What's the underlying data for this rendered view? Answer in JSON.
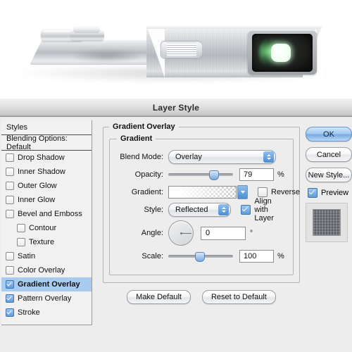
{
  "photo": {
    "subject": "brushed-aluminum camera body with lens",
    "parts": [
      "dial-knob-large",
      "dial-knob-small",
      "ridged-grille",
      "lens-housing",
      "lens-highlight"
    ]
  },
  "dialog": {
    "title": "Layer Style"
  },
  "styles_panel": {
    "header": "Styles",
    "blending_options": "Blending Options: Default",
    "items": [
      {
        "label": "Drop Shadow",
        "checked": false,
        "indent": false,
        "selected": false
      },
      {
        "label": "Inner Shadow",
        "checked": false,
        "indent": false,
        "selected": false
      },
      {
        "label": "Outer Glow",
        "checked": false,
        "indent": false,
        "selected": false
      },
      {
        "label": "Inner Glow",
        "checked": false,
        "indent": false,
        "selected": false
      },
      {
        "label": "Bevel and Emboss",
        "checked": false,
        "indent": false,
        "selected": false
      },
      {
        "label": "Contour",
        "checked": false,
        "indent": true,
        "selected": false
      },
      {
        "label": "Texture",
        "checked": false,
        "indent": true,
        "selected": false
      },
      {
        "label": "Satin",
        "checked": false,
        "indent": false,
        "selected": false
      },
      {
        "label": "Color Overlay",
        "checked": false,
        "indent": false,
        "selected": false
      },
      {
        "label": "Gradient Overlay",
        "checked": true,
        "indent": false,
        "selected": true
      },
      {
        "label": "Pattern Overlay",
        "checked": true,
        "indent": false,
        "selected": false
      },
      {
        "label": "Stroke",
        "checked": true,
        "indent": false,
        "selected": false
      }
    ]
  },
  "gradient_panel": {
    "section_title": "Gradient Overlay",
    "group_title": "Gradient",
    "blend_mode": {
      "label": "Blend Mode:",
      "value": "Overlay"
    },
    "opacity": {
      "label": "Opacity:",
      "value": "79",
      "unit": "%",
      "percent": 72
    },
    "gradient": {
      "label": "Gradient:"
    },
    "reverse": {
      "label": "Reverse",
      "checked": false
    },
    "style": {
      "label": "Style:",
      "value": "Reflected"
    },
    "align_with_layer": {
      "label": "Align with Layer",
      "checked": true
    },
    "angle": {
      "label": "Angle:",
      "value": "0",
      "unit": "°",
      "degrees": 0
    },
    "scale": {
      "label": "Scale:",
      "value": "100",
      "unit": "%",
      "percent": 48
    },
    "make_default": "Make Default",
    "reset_to_default": "Reset to Default"
  },
  "actions": {
    "ok": "OK",
    "cancel": "Cancel",
    "new_style": "New Style...",
    "preview": {
      "label": "Preview",
      "checked": true
    }
  },
  "colors": {
    "accent": "#5f9ddd",
    "selection": "#a8cbf0",
    "dialog_bg": "#ededed",
    "titlebar": "#e3e3e3"
  }
}
